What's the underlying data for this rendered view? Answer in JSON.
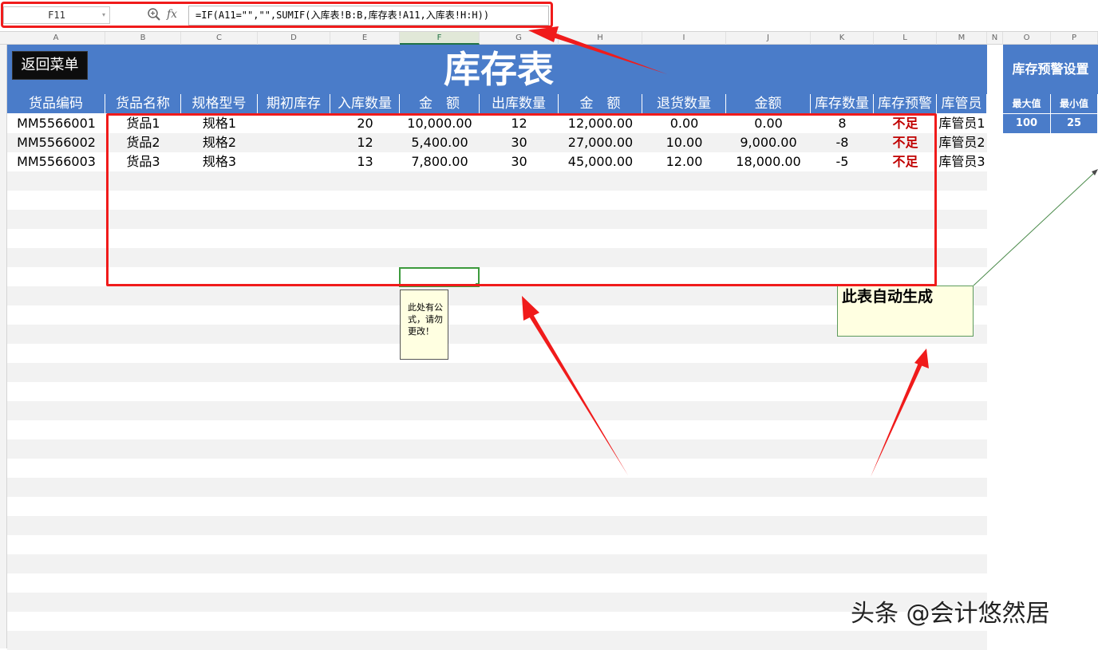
{
  "formula_bar": {
    "name_box": "F11",
    "fx_label": "fx",
    "formula": "=IF(A11=\"\",\"\",SUMIF(入库表!B:B,库存表!A11,入库表!H:H))"
  },
  "columns": [
    "A",
    "B",
    "C",
    "D",
    "E",
    "F",
    "G",
    "H",
    "I",
    "J",
    "K",
    "L",
    "M",
    "N",
    "O",
    "P"
  ],
  "selected_column": "F",
  "sheet": {
    "back_button": "返回菜单",
    "title": "库存表",
    "headers": [
      "货品编码",
      "货品名称",
      "规格型号",
      "期初库存",
      "入库数量",
      "金　额",
      "出库数量",
      "金　额",
      "退货数量",
      "金额",
      "库存数量",
      "库存预警",
      "库管员"
    ],
    "rows": [
      [
        "MM5566001",
        "货品1",
        "规格1",
        "",
        "20",
        "10,000.00",
        "12",
        "12,000.00",
        "0.00",
        "0.00",
        "8",
        "不足",
        "库管员1"
      ],
      [
        "MM5566002",
        "货品2",
        "规格2",
        "",
        "12",
        "5,400.00",
        "30",
        "27,000.00",
        "10.00",
        "9,000.00",
        "-8",
        "不足",
        "库管员2"
      ],
      [
        "MM5566003",
        "货品3",
        "规格3",
        "",
        "13",
        "7,800.00",
        "30",
        "45,000.00",
        "12.00",
        "18,000.00",
        "-5",
        "不足",
        "库管员3"
      ]
    ]
  },
  "side_panel": {
    "title": "库存预警设置",
    "max_label": "最大值",
    "min_label": "最小值",
    "max_value": "100",
    "min_value": "25"
  },
  "notes": {
    "formula_note": "此处有公式，请勿更改！",
    "auto_note": "此表自动生成"
  },
  "watermark": "头条 @会计悠然居",
  "colors": {
    "header_blue": "#4a7cc9",
    "annotation_red": "#f01b1b",
    "warning_red": "#c00000",
    "selection_green": "#3c9a3c"
  }
}
